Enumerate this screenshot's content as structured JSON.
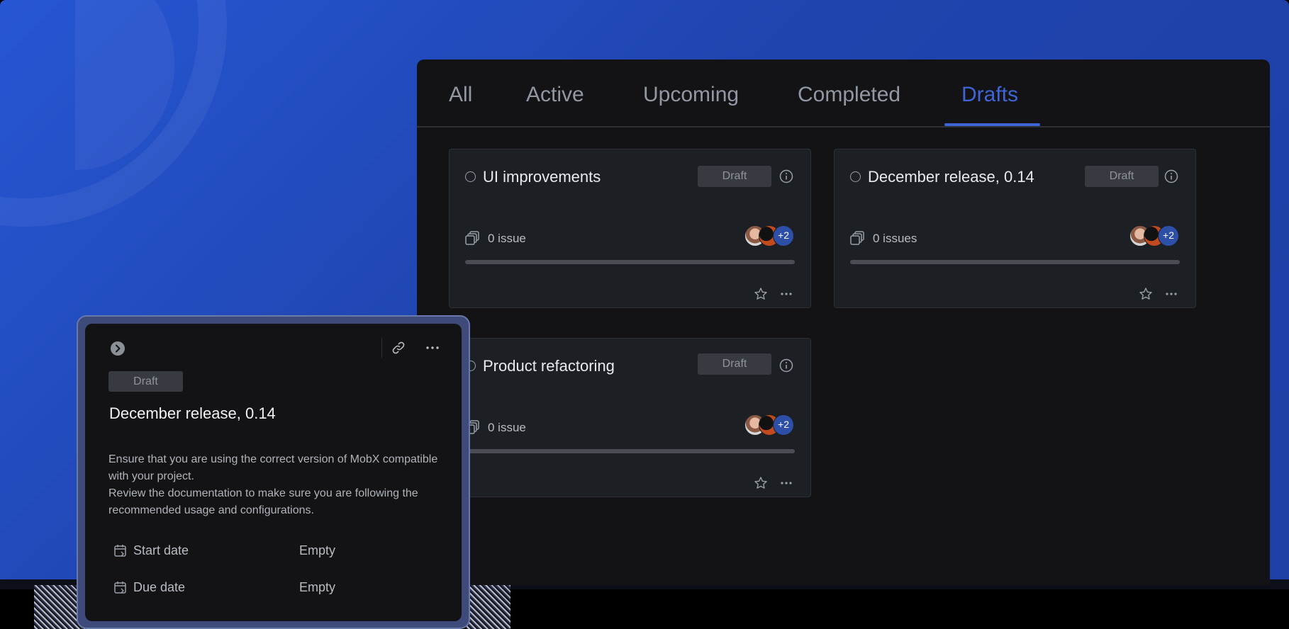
{
  "tabs": [
    {
      "label": "All"
    },
    {
      "label": "Active"
    },
    {
      "label": "Upcoming"
    },
    {
      "label": "Completed"
    },
    {
      "label": "Drafts"
    }
  ],
  "active_tab": "Drafts",
  "cards": [
    {
      "title": "UI improvements",
      "badge": "Draft",
      "issues": "0 issue",
      "avatar_more": "+2"
    },
    {
      "title": "December release, 0.14",
      "badge": "Draft",
      "issues": "0 issues",
      "avatar_more": "+2"
    },
    {
      "title": "Product refactoring",
      "badge": "Draft",
      "issues": "0 issue",
      "avatar_more": "+2"
    }
  ],
  "panel": {
    "badge": "Draft",
    "title": "December release, 0.14",
    "description": [
      "Ensure that you are using the correct version of MobX compatible with your project.",
      "Review the documentation to make sure you are following the recommended usage and configurations."
    ],
    "properties": [
      {
        "label": "Start date",
        "value": "Empty",
        "icon": "calendar-icon"
      },
      {
        "label": "Due date",
        "value": "Empty",
        "icon": "calendar-icon"
      }
    ]
  },
  "colors": {
    "accent": "#3f64d6",
    "background_blue": "#1f44ad",
    "panel_bg": "#131316",
    "card_bg": "#1c1f24"
  }
}
